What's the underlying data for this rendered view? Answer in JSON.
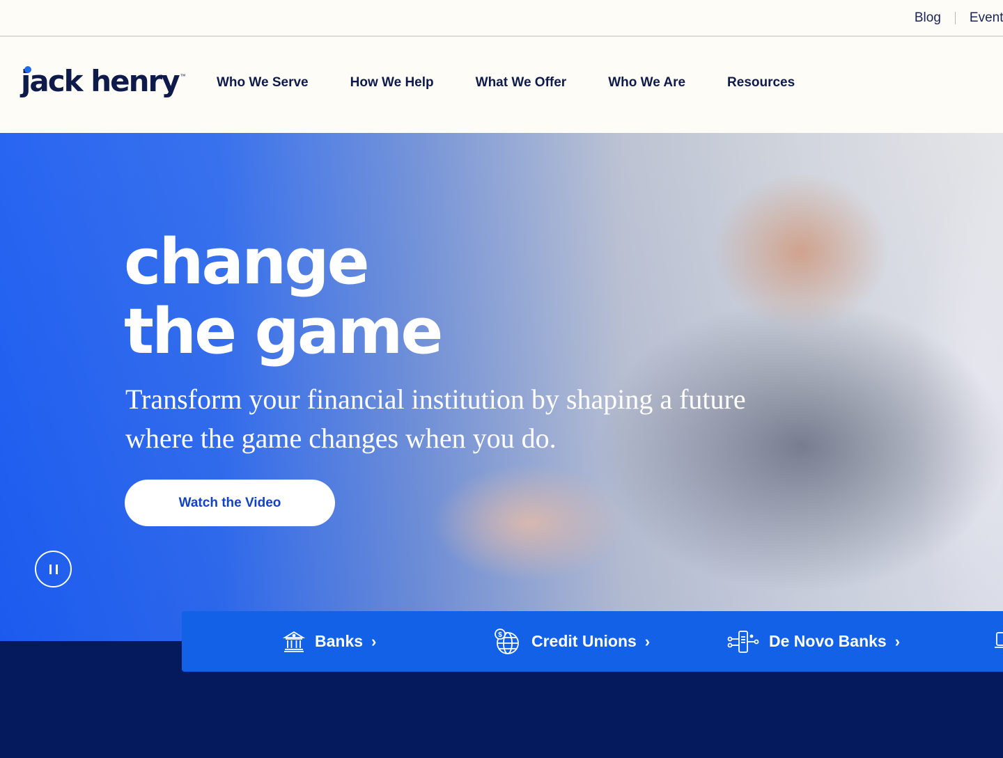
{
  "utility": {
    "blog": "Blog",
    "events": "Events"
  },
  "logo": {
    "text": "jack henry",
    "tm": "™"
  },
  "nav": {
    "items": [
      {
        "label": "Who We Serve"
      },
      {
        "label": "How We Help"
      },
      {
        "label": "What We Offer"
      },
      {
        "label": "Who We Are"
      },
      {
        "label": "Resources"
      }
    ]
  },
  "hero": {
    "title_line1": "change",
    "title_line2": "the game",
    "subtitle": "Transform your financial institution by shaping a future where the game changes when you do.",
    "cta_label": "Watch the Video"
  },
  "categories": {
    "items": [
      {
        "label": "Banks",
        "icon": "bank-icon"
      },
      {
        "label": "Credit Unions",
        "icon": "globe-dollar-icon"
      },
      {
        "label": "De Novo Banks",
        "icon": "mobile-network-icon"
      }
    ]
  },
  "colors": {
    "brand_navy": "#0e1a4a",
    "brand_blue": "#1261e6",
    "dark_band": "#051a5c",
    "hero_blue": "#1b5cf0"
  }
}
